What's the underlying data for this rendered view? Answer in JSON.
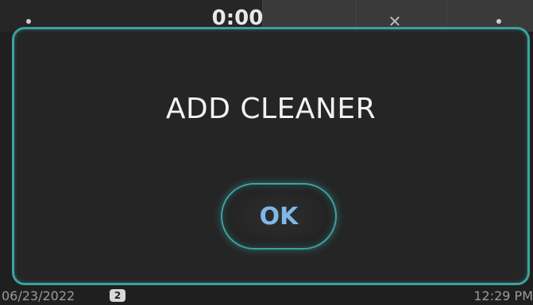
{
  "background": {
    "timer": "0:00"
  },
  "dialog": {
    "message": "ADD CLEANER",
    "ok_label": "OK"
  },
  "status_bar": {
    "date": "06/23/2022",
    "badge_count": "2",
    "time": "12:29 PM"
  },
  "colors": {
    "accent": "#3aa3a0",
    "ok_text": "#7fb8e8",
    "dialog_bg": "#252525",
    "message_text": "#f2f2f2"
  }
}
